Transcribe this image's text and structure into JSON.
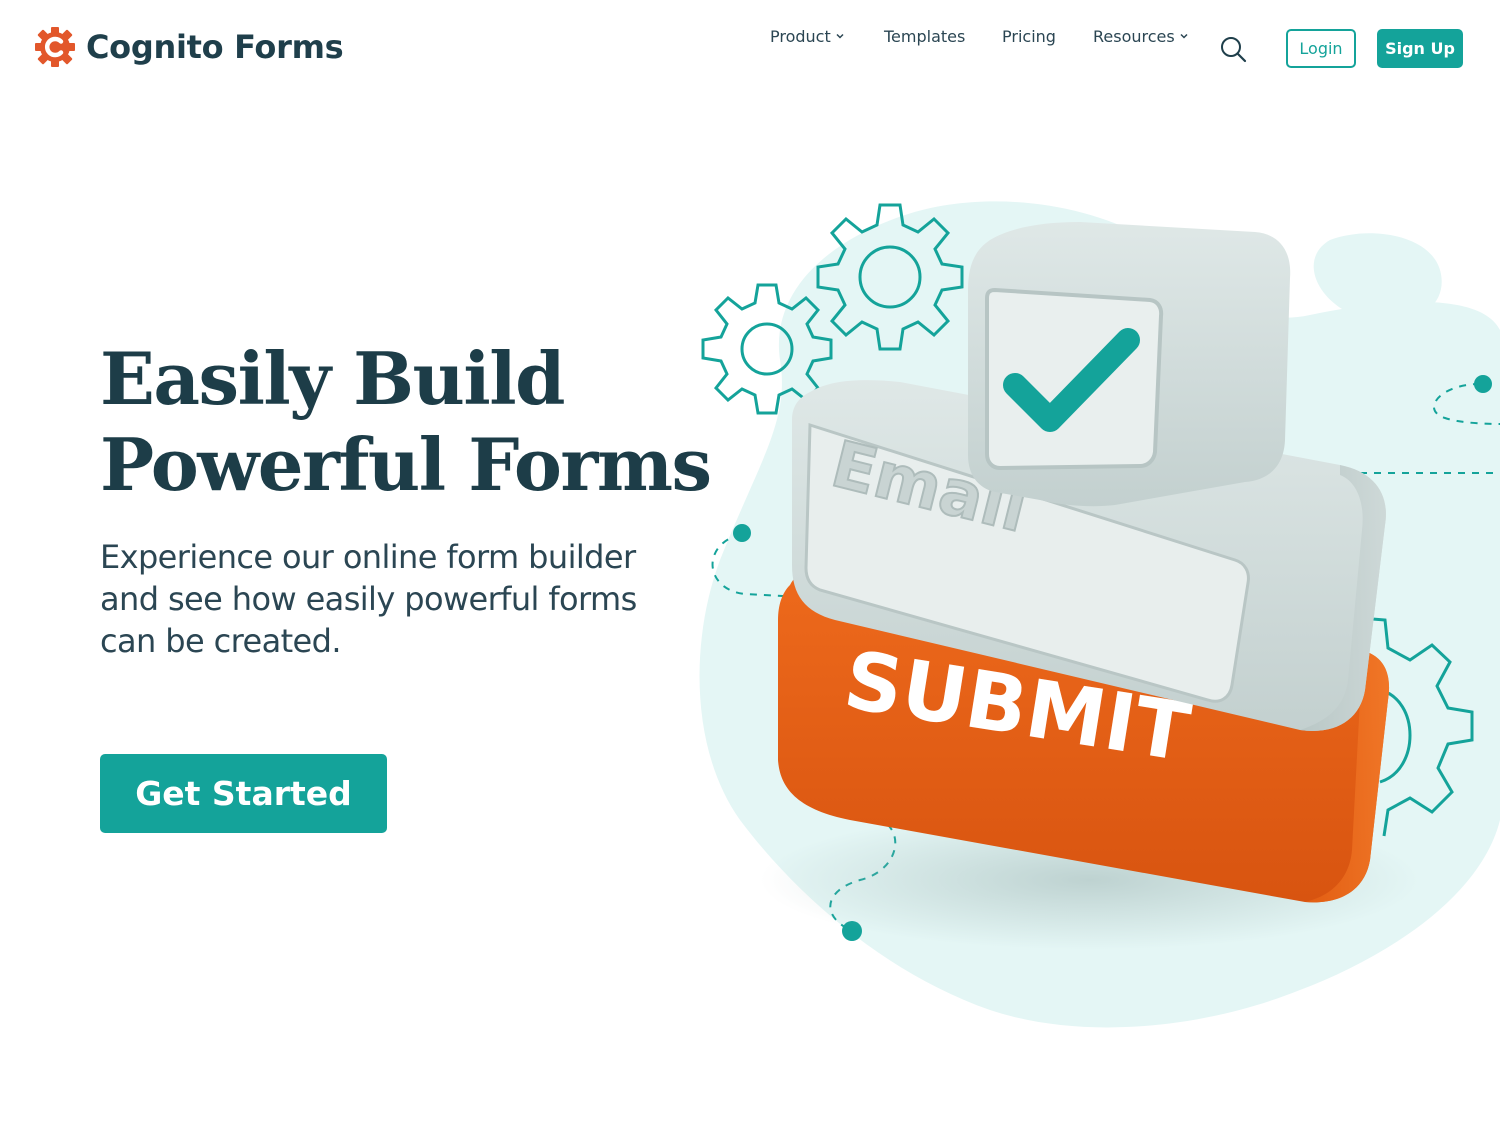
{
  "brand": {
    "name": "Cognito Forms",
    "logo_icon": "cognito-gear-logo-icon",
    "logo_color": "#e2572b"
  },
  "nav": {
    "items": [
      {
        "label": "Product",
        "has_dropdown": true
      },
      {
        "label": "Templates",
        "has_dropdown": false
      },
      {
        "label": "Pricing",
        "has_dropdown": false
      },
      {
        "label": "Resources",
        "has_dropdown": true
      }
    ],
    "search_icon": "search-icon",
    "login_label": "Login",
    "signup_label": "Sign Up"
  },
  "hero": {
    "title_line1": "Easily Build",
    "title_line2": "Powerful Forms",
    "subtitle": "Experience our online form builder and see how easily powerful forms can be created.",
    "cta_label": "Get Started"
  },
  "illustration": {
    "block_labels": {
      "email": "Email",
      "submit": "SUBMIT"
    },
    "icons": [
      "gear-icon",
      "checkmark-icon"
    ]
  },
  "colors": {
    "accent": "#14a39a",
    "heading": "#1d3d48",
    "submit_orange": "#e25d12",
    "blob": "#e4f6f5"
  }
}
